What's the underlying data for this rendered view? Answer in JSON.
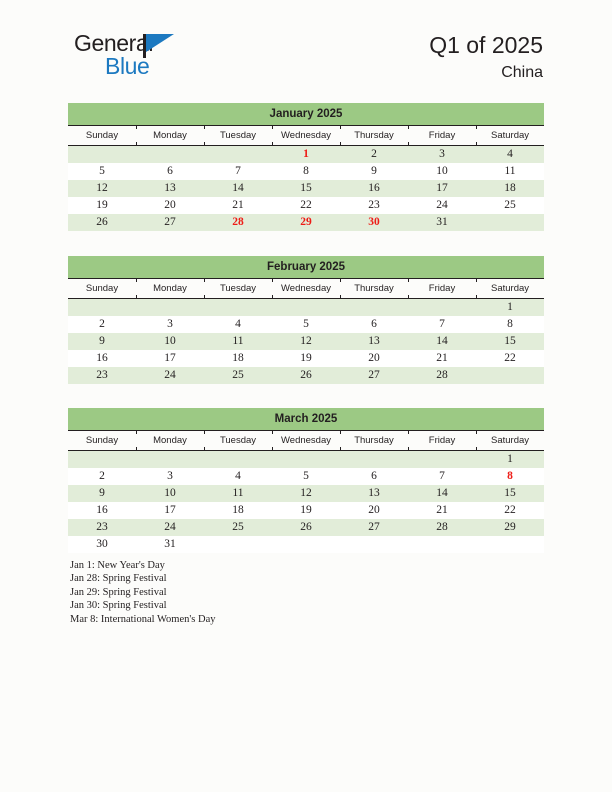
{
  "brand": {
    "name_part1": "General",
    "name_part2": "Blue",
    "flag_icon": "blue-triangle-flag-icon",
    "color_dark": "#231f20",
    "color_blue": "#1c79c0"
  },
  "header": {
    "title": "Q1 of 2025",
    "subtitle": "China"
  },
  "theme": {
    "month_header_bg": "#9cc984",
    "row_shaded_bg": "#e2edd9",
    "row_plain_bg": "#ffffff",
    "holiday_color": "#ee1c16",
    "text_color": "#231f20",
    "page_bg": "#fcfcfa"
  },
  "weekdays": [
    "Sunday",
    "Monday",
    "Tuesday",
    "Wednesday",
    "Thursday",
    "Friday",
    "Saturday"
  ],
  "months": [
    {
      "title": "January 2025",
      "weeks": [
        [
          "",
          "",
          "",
          "1",
          "2",
          "3",
          "4"
        ],
        [
          "5",
          "6",
          "7",
          "8",
          "9",
          "10",
          "11"
        ],
        [
          "12",
          "13",
          "14",
          "15",
          "16",
          "17",
          "18"
        ],
        [
          "19",
          "20",
          "21",
          "22",
          "23",
          "24",
          "25"
        ],
        [
          "26",
          "27",
          "28",
          "29",
          "30",
          "31",
          ""
        ]
      ],
      "holidays": [
        "1",
        "28",
        "29",
        "30"
      ]
    },
    {
      "title": "February 2025",
      "weeks": [
        [
          "",
          "",
          "",
          "",
          "",
          "",
          "1"
        ],
        [
          "2",
          "3",
          "4",
          "5",
          "6",
          "7",
          "8"
        ],
        [
          "9",
          "10",
          "11",
          "12",
          "13",
          "14",
          "15"
        ],
        [
          "16",
          "17",
          "18",
          "19",
          "20",
          "21",
          "22"
        ],
        [
          "23",
          "24",
          "25",
          "26",
          "27",
          "28",
          ""
        ]
      ],
      "holidays": []
    },
    {
      "title": "March 2025",
      "weeks": [
        [
          "",
          "",
          "",
          "",
          "",
          "",
          "1"
        ],
        [
          "2",
          "3",
          "4",
          "5",
          "6",
          "7",
          "8"
        ],
        [
          "9",
          "10",
          "11",
          "12",
          "13",
          "14",
          "15"
        ],
        [
          "16",
          "17",
          "18",
          "19",
          "20",
          "21",
          "22"
        ],
        [
          "23",
          "24",
          "25",
          "26",
          "27",
          "28",
          "29"
        ],
        [
          "30",
          "31",
          "",
          "",
          "",
          "",
          ""
        ]
      ],
      "holidays": [
        "8"
      ]
    }
  ],
  "legend": [
    "Jan 1: New Year's Day",
    "Jan 28: Spring Festival",
    "Jan 29: Spring Festival",
    "Jan 30: Spring Festival",
    "Mar 8: International Women's Day"
  ]
}
